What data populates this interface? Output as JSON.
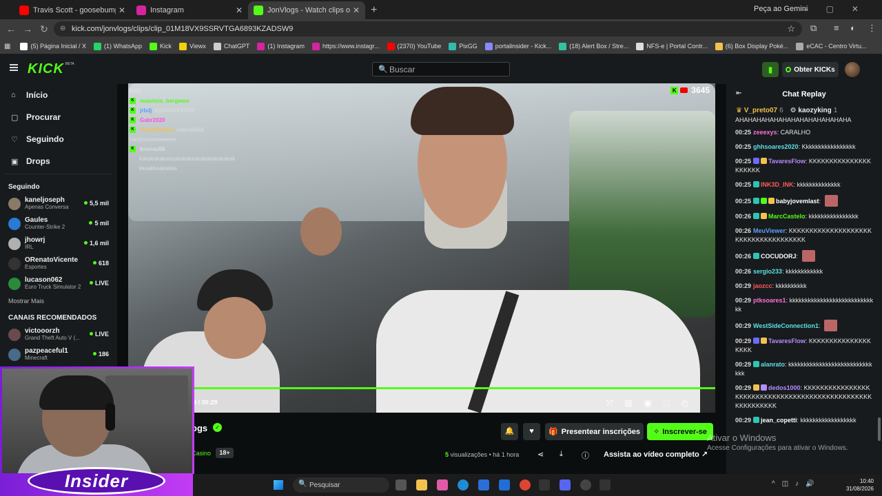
{
  "browser": {
    "tabs": [
      {
        "title": "Travis Scott - goosebumps (Offi",
        "color": "#ff0000"
      },
      {
        "title": "Instagram",
        "color": "#d6249f"
      },
      {
        "title": "JonVlogs - Watch clips on Kick",
        "color": "#53fc18"
      }
    ],
    "gemini": "Peça ao Gemini",
    "url": "kick.com/jonvlogs/clips/clip_01M18VX9SSRVTGA6893KZADSW9",
    "bookmarks": [
      {
        "label": "(5) Página Inicial / X",
        "color": "#ffffff"
      },
      {
        "label": "(1) WhatsApp",
        "color": "#25d366"
      },
      {
        "label": "Kick",
        "color": "#53fc18"
      },
      {
        "label": "Viewx",
        "color": "#f5d10a"
      },
      {
        "label": "ChatGPT",
        "color": "#cccccc"
      },
      {
        "label": "(1) Instagram",
        "color": "#d6249f"
      },
      {
        "label": "https://www.instagr...",
        "color": "#d6249f"
      },
      {
        "label": "(2370) YouTube",
        "color": "#ff0000"
      },
      {
        "label": "PixGG",
        "color": "#32bcad"
      },
      {
        "label": "portalinsider - Kick...",
        "color": "#8888ff"
      },
      {
        "label": "(18) Alert Box / Stre...",
        "color": "#31c3a2"
      },
      {
        "label": "NFS-e | Portal Contr...",
        "color": "#dddddd"
      },
      {
        "label": "(6) Box Display Poké...",
        "color": "#f2c14e"
      },
      {
        "label": "eCAC - Centro Virtu...",
        "color": "#aaaaaa"
      }
    ]
  },
  "kick": {
    "logo": "KICK",
    "beta": "BETA",
    "search_placeholder": "Buscar",
    "get_kicks": "Obter KICKs"
  },
  "sidebar": {
    "nav": [
      {
        "label": "Início",
        "icon": "⌂"
      },
      {
        "label": "Procurar",
        "icon": "▢"
      },
      {
        "label": "Seguindo",
        "icon": "♡"
      },
      {
        "label": "Drops",
        "icon": "▣"
      }
    ],
    "following_title": "Seguindo",
    "following": [
      {
        "name": "kaneljoseph",
        "game": "Apenas Conversa",
        "viewers": "5,5 mil",
        "color": "#8a7a6a"
      },
      {
        "name": "Gaules",
        "game": "Counter-Strike 2",
        "viewers": "5 mil",
        "color": "#2a7ad4"
      },
      {
        "name": "jhowrj",
        "game": "IRL",
        "viewers": "1,6 mil",
        "color": "#b0b0b0"
      },
      {
        "name": "ORenatoVicente",
        "game": "Esportes",
        "viewers": "618",
        "color": "#333333"
      },
      {
        "name": "lucason062",
        "game": "Euro Truck Simulator 2",
        "viewers": "LIVE",
        "color": "#2a8a3a"
      }
    ],
    "more": "Mostrar Mais",
    "recommended_title": "CANAIS RECOMENDADOS",
    "recommended": [
      {
        "name": "victooorzh",
        "game": "Grand Theft Auto V (...",
        "viewers": "LIVE",
        "color": "#6a4a4a"
      },
      {
        "name": "pazpeaceful1",
        "game": "Minecraft",
        "viewers": "186",
        "color": "#4a6a8a"
      }
    ]
  },
  "video": {
    "viewers": "3645",
    "time": "9 / 00:29",
    "overlay_chat": [
      {
        "user": "KKK",
        "text": "",
        "color": "#dddddd",
        "badge": false
      },
      {
        "user": "mauricio_bergamo",
        "text": "",
        "color": "#53fc18",
        "badge": true
      },
      {
        "user": "jrbdj",
        "text": "KKKKKKKKKKK",
        "color": "#5aa0ff",
        "badge": true
      },
      {
        "user": "Gabr2020",
        "text": "",
        "color": "#ff4fd8",
        "badge": true
      },
      {
        "user": "PauloBVieira",
        "text": "caaraiiiiiiiiiii",
        "color": "#f2c14e",
        "badge": true
      },
      {
        "user": "",
        "text": "hardcoreeeeeeeee",
        "color": "#dddddd",
        "badge": false
      },
      {
        "user": "brunou56",
        "text": "",
        "color": "#dddddd",
        "badge": true
      },
      {
        "user": "",
        "text": "kakakakakakaakakakkakakakakakakak",
        "color": "#dddddd",
        "badge": false
      },
      {
        "user": "",
        "text": "kkaakkaakakka",
        "color": "#dddddd",
        "badge": false
      }
    ]
  },
  "channel": {
    "name": "ogs",
    "category": "Casino",
    "age": "18+",
    "gift": "Presentear inscrições",
    "subscribe": "Inscrever-se",
    "views_num": "5",
    "views_label": "visualizações",
    "ago": "• há 1 hora",
    "watch_full": "Assista ao vídeo completo"
  },
  "windows_activation": {
    "line1": "Ativar o Windows",
    "line2": "Acesse Configurações para ativar o Windows."
  },
  "chat": {
    "title": "Chat Replay",
    "gifters": [
      {
        "name": "V_preto07",
        "count": "6"
      },
      {
        "name": "kaozyking",
        "count": "1"
      }
    ],
    "top_text": "AHAHAHAHAHAHAHAHAHAHAHAHAHA",
    "messages": [
      {
        "time": "00:25",
        "user": "zeeexys",
        "color": "#ff6fd8",
        "text": "CARALHO",
        "badges": [],
        "emote": false
      },
      {
        "time": "00:25",
        "user": "ghhsoares2020",
        "color": "#5ce1e6",
        "text": "Kkkkkkkkkkkkkkkkk",
        "badges": [],
        "emote": false
      },
      {
        "time": "00:25",
        "user": "TavaresFlow",
        "color": "#b58cff",
        "text": "KKKKKKKKKKKKKKKKKKKKK",
        "badges": [
          "#6b6bff",
          "#f2c14e"
        ],
        "emote": false
      },
      {
        "time": "00:25",
        "user": "INK3D_INK",
        "color": "#ff5a5a",
        "text": "kkkkkkkkkkkkkk",
        "badges": [
          "#2ec4b6"
        ],
        "emote": false
      },
      {
        "time": "00:25",
        "user": "babyjovemlast",
        "color": "#ffffff",
        "text": "",
        "badges": [
          "#2ec4b6",
          "#53fc18",
          "#f2c14e"
        ],
        "emote": true
      },
      {
        "time": "00:26",
        "user": "MarcCastelo",
        "color": "#53fc18",
        "text": "kkkkkkkkkkkkkkkk",
        "badges": [
          "#2ec4b6",
          "#f2c14e"
        ],
        "emote": false
      },
      {
        "time": "00:26",
        "user": "MeuViewer",
        "color": "#5aa0ff",
        "text": "KKKKKKKKKKKKKKKKKKKKKKKKKKKKKKKKKKKKK",
        "badges": [],
        "emote": false
      },
      {
        "time": "00:26",
        "user": "COCUDORJ",
        "color": "#ffffff",
        "text": "",
        "badges": [
          "#2ec4b6"
        ],
        "emote": true
      },
      {
        "time": "00:26",
        "user": "sergio233",
        "color": "#5ce1e6",
        "text": "kkkkkkkkkkkk",
        "badges": [],
        "emote": false
      },
      {
        "time": "00:29",
        "user": "jaozcc",
        "color": "#ff5a5a",
        "text": "kkkkkkkkkk",
        "badges": [],
        "emote": false
      },
      {
        "time": "00:29",
        "user": "ptksoares1",
        "color": "#ff6fd8",
        "text": "kkkkkkkkkkkkkkkkkkkkkkkkkkkkk",
        "badges": [],
        "emote": false
      },
      {
        "time": "00:29",
        "user": "WestSideConnection1",
        "color": "#5ce1e6",
        "text": "",
        "badges": [],
        "emote": true
      },
      {
        "time": "00:29",
        "user": "TavaresFlow",
        "color": "#b58cff",
        "text": "KKKKKKKKKKKKKKKKKKK",
        "badges": [
          "#6b6bff",
          "#f2c14e"
        ],
        "emote": false
      },
      {
        "time": "00:29",
        "user": "alanrato",
        "color": "#5ce1e6",
        "text": "kkkkkkkkkkkkkkkkkkkkkkkkkkkkkk",
        "badges": [
          "#2ec4b6"
        ],
        "emote": false
      },
      {
        "time": "00:29",
        "user": "dedos1000",
        "color": "#b58cff",
        "text": "KKKKKKKKKKKKKKKKKKKKKKKKKKKKKKKKKKKKKKKKKKKKKKKKKKKKKKKKKKK",
        "badges": [
          "#f2c14e",
          "#b58cff"
        ],
        "emote": false
      },
      {
        "time": "00:29",
        "user": "jean_copetti",
        "color": "#ffffff",
        "text": "kkkkkkkkkkkkkkkkkk",
        "badges": [
          "#2ec4b6"
        ],
        "emote": false
      }
    ]
  },
  "webcam": {
    "brand": "Insider"
  },
  "taskbar": {
    "search": "Pesquisar",
    "time": "10:40",
    "date": "31/08/2026"
  }
}
